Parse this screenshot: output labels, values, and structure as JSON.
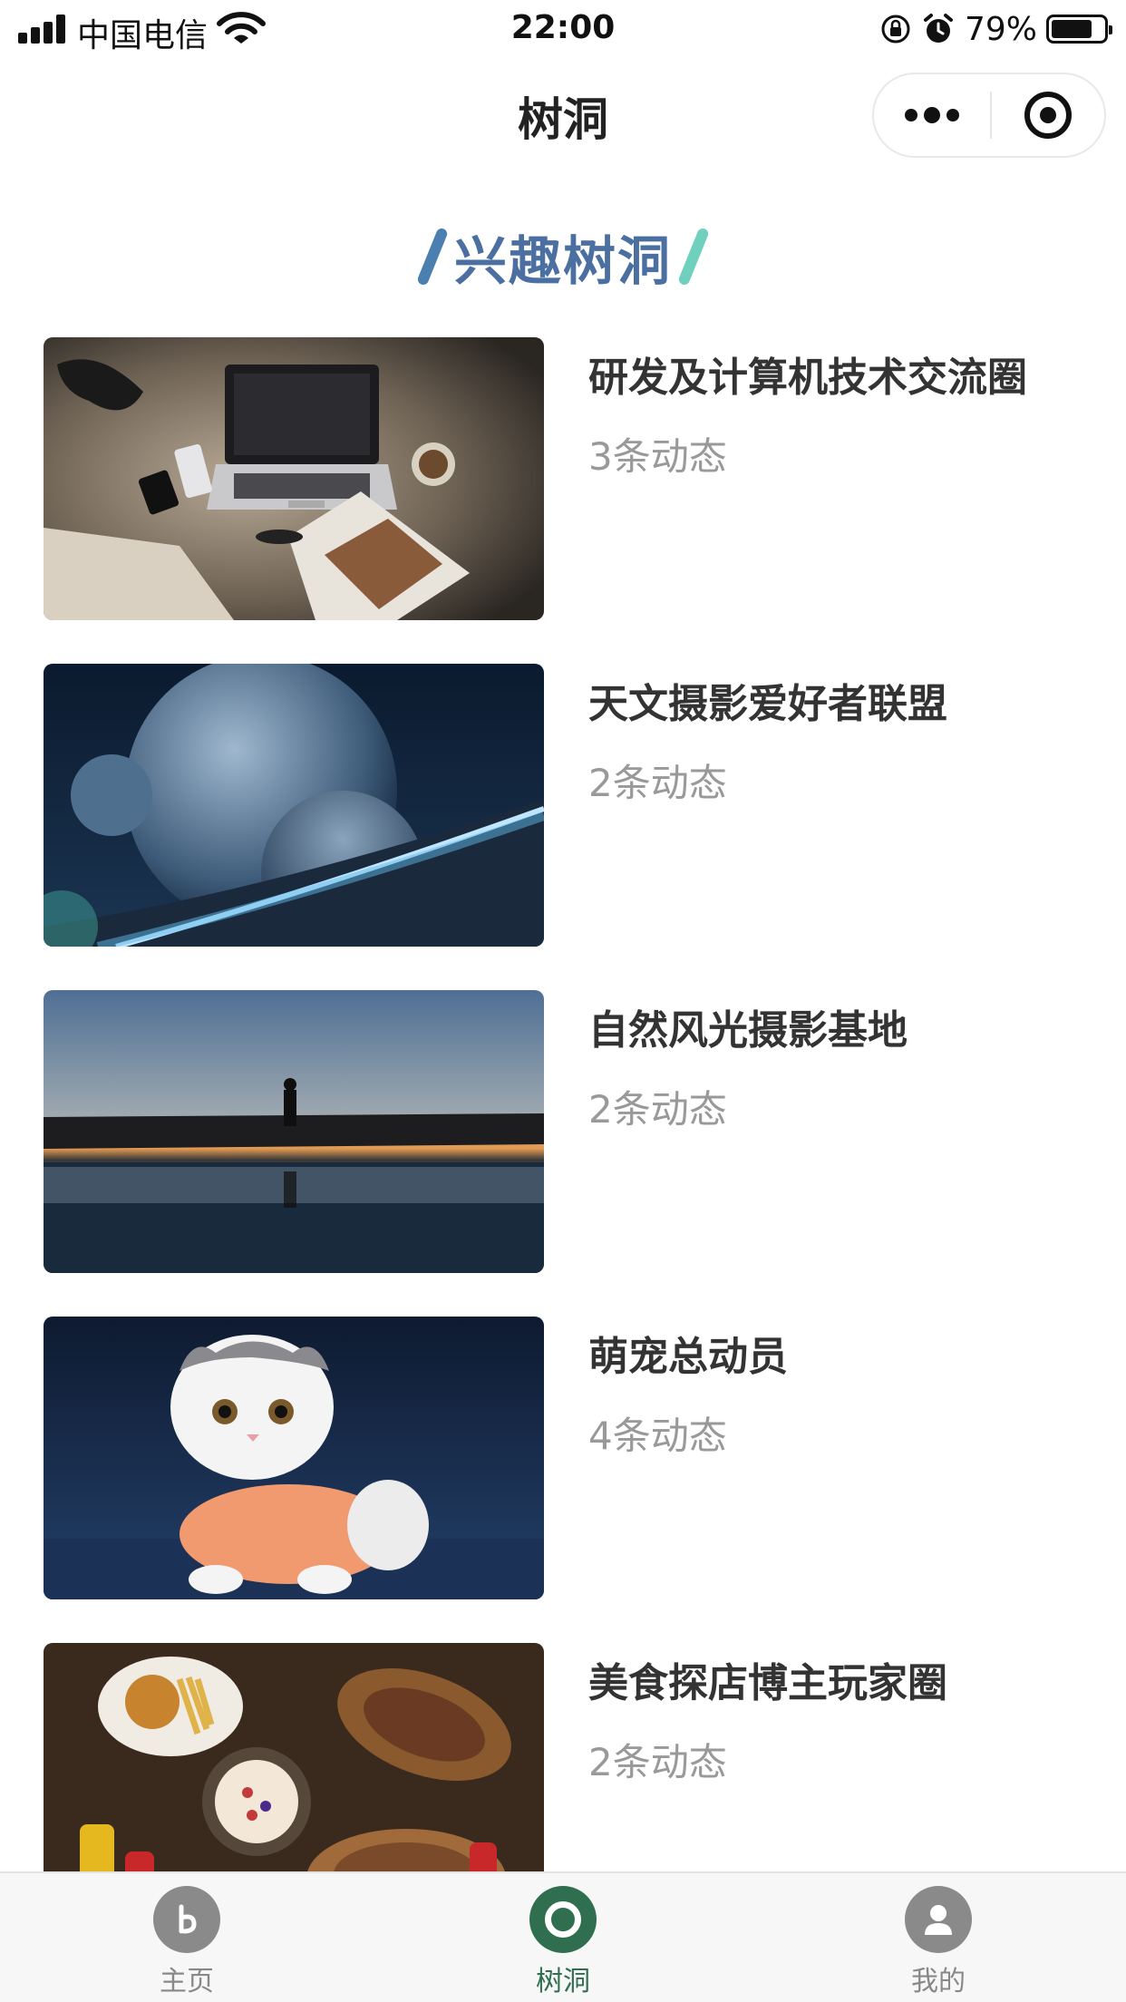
{
  "status_bar": {
    "carrier": "中国电信",
    "time": "22:00",
    "battery_percent": "79%"
  },
  "nav": {
    "title": "树洞"
  },
  "section": {
    "title": "兴趣树洞",
    "slash_left_color": "#4a7fb0",
    "slash_right_color": "#6fd0bd"
  },
  "groups": [
    {
      "title": "研发及计算机技术交流圈",
      "count": "3条动态",
      "image": "laptop-desk-photo"
    },
    {
      "title": "天文摄影爱好者联盟",
      "count": "2条动态",
      "image": "planets-space-photo"
    },
    {
      "title": "自然风光摄影基地",
      "count": "2条动态",
      "image": "sunset-photographer-photo"
    },
    {
      "title": "萌宠总动员",
      "count": "4条动态",
      "image": "cat-in-sweater-photo"
    },
    {
      "title": "美食探店博主玩家圈",
      "count": "2条动态",
      "image": "food-table-photo"
    }
  ],
  "tabs": [
    {
      "label": "主页",
      "icon": "home-icon",
      "active": false
    },
    {
      "label": "树洞",
      "icon": "treehole-icon",
      "active": true
    },
    {
      "label": "我的",
      "icon": "profile-icon",
      "active": false
    }
  ],
  "colors": {
    "accent_green": "#2f6e4f",
    "title_blue": "#4a6fa0",
    "muted_text": "#999999"
  }
}
